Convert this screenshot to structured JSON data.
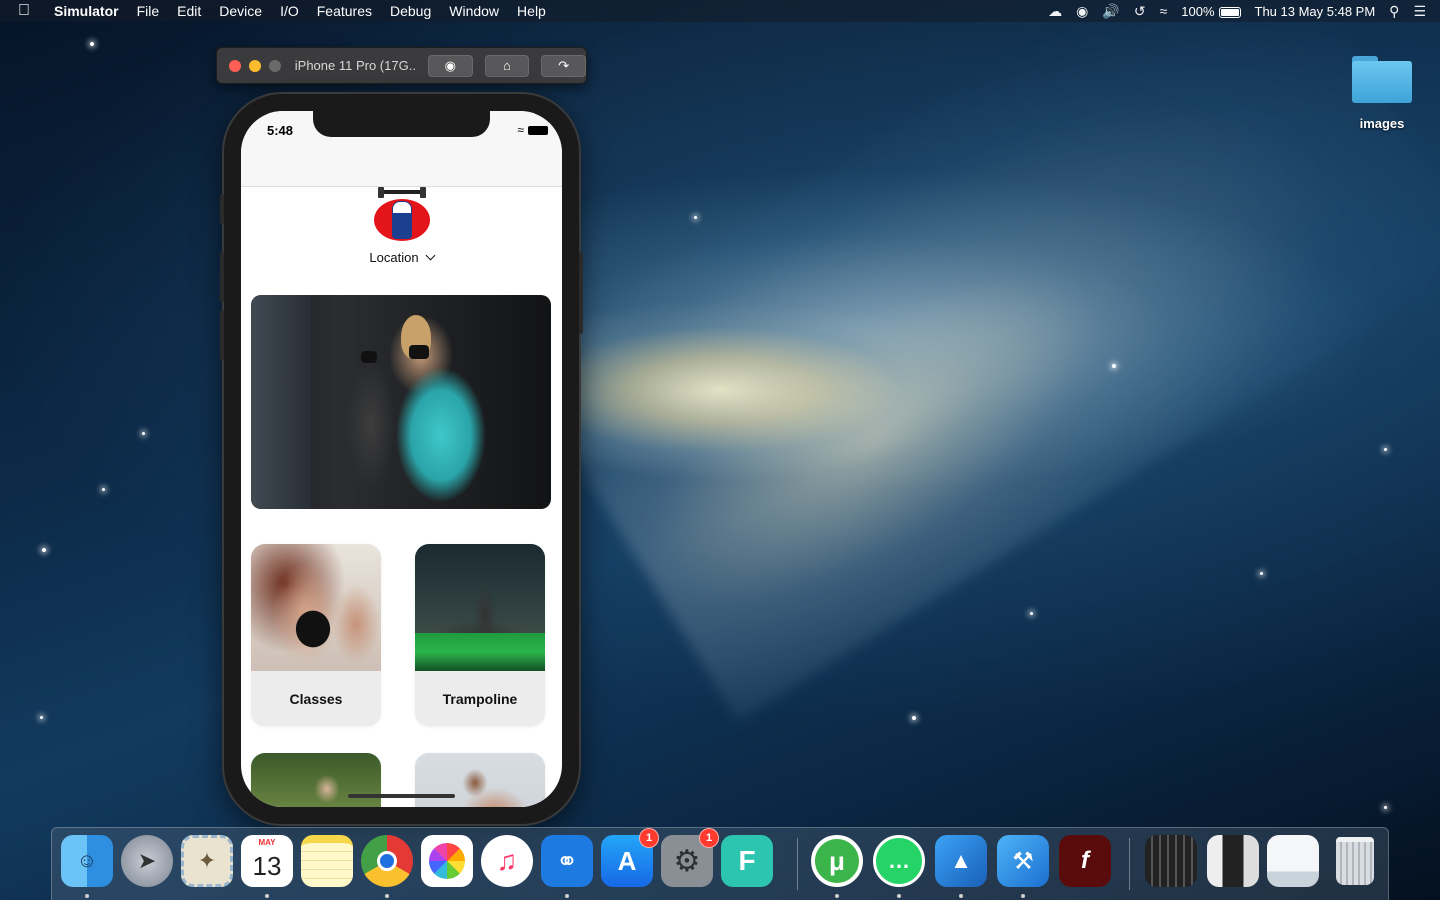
{
  "menubar": {
    "app_name": "Simulator",
    "menus": [
      "File",
      "Edit",
      "Device",
      "I/O",
      "Features",
      "Debug",
      "Window",
      "Help"
    ],
    "battery": "100%",
    "datetime": "Thu 13 May  5:48 PM"
  },
  "desktop": {
    "folder_label": "images"
  },
  "simulator": {
    "title": "iPhone 11 Pro (17G...",
    "buttons": [
      "screenshot-icon",
      "home-icon",
      "rotate-icon"
    ]
  },
  "app": {
    "status_time": "5:48",
    "location_label": "Location",
    "cards": [
      {
        "label": "Classes"
      },
      {
        "label": "Trampoline"
      },
      {
        "label": ""
      },
      {
        "label": ""
      }
    ]
  },
  "dock": {
    "items": [
      {
        "name": "finder",
        "icon": "finder-icon"
      },
      {
        "name": "launchpad",
        "icon": "rocket-icon"
      },
      {
        "name": "mail",
        "icon": "stamp-icon"
      },
      {
        "name": "calendar",
        "icon": "calendar-icon",
        "month": "MAY",
        "day": "13"
      },
      {
        "name": "notes",
        "icon": "notes-icon"
      },
      {
        "name": "chrome",
        "icon": "chrome-icon"
      },
      {
        "name": "photos",
        "icon": "photos-icon"
      },
      {
        "name": "music",
        "icon": "music-note-icon"
      },
      {
        "name": "sourcetree",
        "icon": "sourcetree-icon"
      },
      {
        "name": "app-store",
        "icon": "app-store-icon",
        "badge": "1"
      },
      {
        "name": "system-preferences",
        "icon": "gear-icon",
        "badge": "1"
      },
      {
        "name": "filmora",
        "icon": "filmora-icon"
      },
      {
        "name": "utorrent",
        "icon": "utorrent-icon"
      },
      {
        "name": "whatsapp",
        "icon": "whatsapp-icon"
      },
      {
        "name": "simulator",
        "icon": "simulator-icon"
      },
      {
        "name": "xcode",
        "icon": "xcode-icon"
      },
      {
        "name": "flash",
        "icon": "flash-icon"
      },
      {
        "name": "stack-1",
        "icon": "stack-icon"
      },
      {
        "name": "stack-2",
        "icon": "stack-icon"
      },
      {
        "name": "stack-3",
        "icon": "stack-icon"
      },
      {
        "name": "trash",
        "icon": "trash-icon"
      }
    ]
  }
}
